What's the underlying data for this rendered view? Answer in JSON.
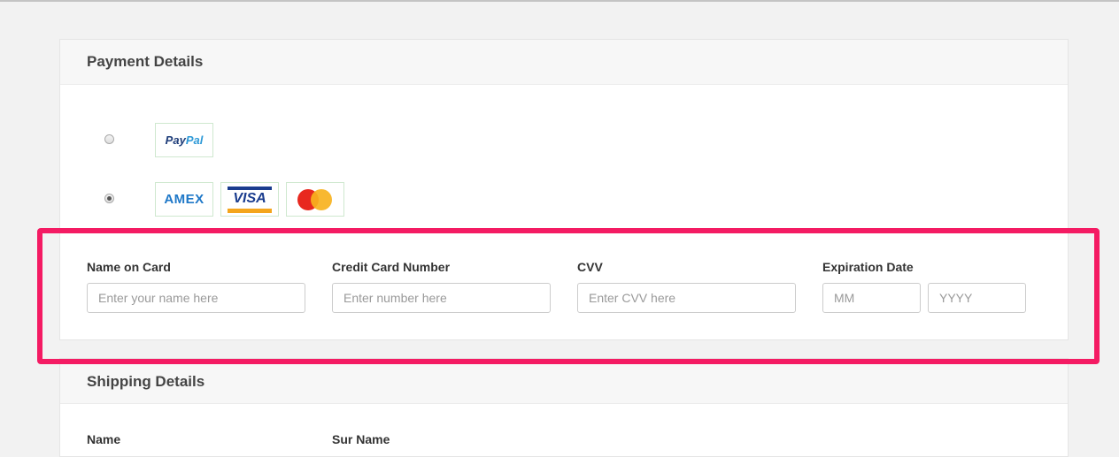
{
  "payment": {
    "title": "Payment Details",
    "methods": [
      {
        "name": "paypal",
        "checked": false,
        "logos": [
          "PayPal"
        ]
      },
      {
        "name": "card",
        "checked": true,
        "logos": [
          "AMEX",
          "VISA",
          "mastercard"
        ]
      }
    ],
    "paypal_logo": {
      "pay": "Pay",
      "pal": "Pal"
    },
    "amex_logo": "AMEX",
    "visa_logo": "VISA",
    "fields": {
      "name_label": "Name on Card",
      "name_placeholder": "Enter your name here",
      "number_label": "Credit Card Number",
      "number_placeholder": "Enter number here",
      "cvv_label": "CVV",
      "cvv_placeholder": "Enter CVV here",
      "expiry_label": "Expiration Date",
      "month_placeholder": "MM",
      "year_placeholder": "YYYY"
    }
  },
  "shipping": {
    "title": "Shipping Details",
    "name_label": "Name",
    "surname_label": "Sur Name"
  },
  "colors": {
    "highlight": "#f41b63",
    "paypal_dark": "#1f3e7a",
    "paypal_light": "#2f9ad7",
    "amex": "#1f78c8",
    "visa_blue": "#1a3c8e",
    "visa_gold": "#f4a51c",
    "mastercard_red": "#e8281f",
    "mastercard_yellow": "#f7b21e"
  }
}
